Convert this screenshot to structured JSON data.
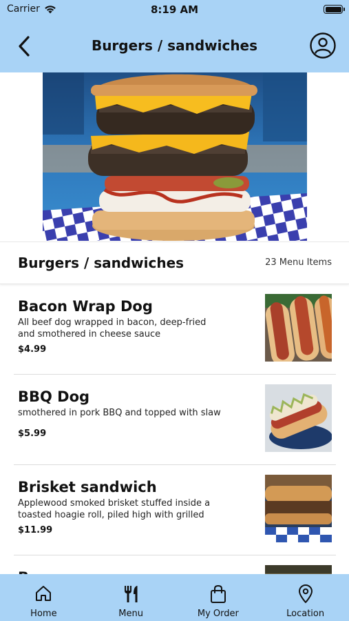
{
  "status_bar": {
    "carrier": "Carrier",
    "time": "8:19 AM"
  },
  "nav": {
    "title": "Burgers / sandwiches",
    "back_icon": "chevron-left-icon",
    "profile_icon": "user-circle-icon"
  },
  "category": {
    "title": "Burgers / sandwiches",
    "count": "23 Menu Items"
  },
  "menu_items": [
    {
      "name": "Bacon Wrap Dog",
      "description": "All beef dog wrapped in bacon, deep-fried and smothered in cheese sauce",
      "price": "$4.99"
    },
    {
      "name": "BBQ Dog",
      "description": "smothered in pork BBQ and topped with slaw",
      "price": "$5.99"
    },
    {
      "name": "Brisket sandwich",
      "description": "Applewood smoked brisket stuffed inside a toasted hoagie roll, piled high with grilled onion...",
      "price": "$11.99"
    },
    {
      "name": "B",
      "description": "",
      "price": ""
    }
  ],
  "tabs": [
    {
      "label": "Home",
      "icon": "home-icon"
    },
    {
      "label": "Menu",
      "icon": "fork-knife-icon"
    },
    {
      "label": "My Order",
      "icon": "shopping-bag-icon"
    },
    {
      "label": "Location",
      "icon": "map-pin-icon"
    }
  ],
  "colors": {
    "header_bg": "#a9d3f6",
    "tabbar_bg": "#a9d3f6"
  }
}
